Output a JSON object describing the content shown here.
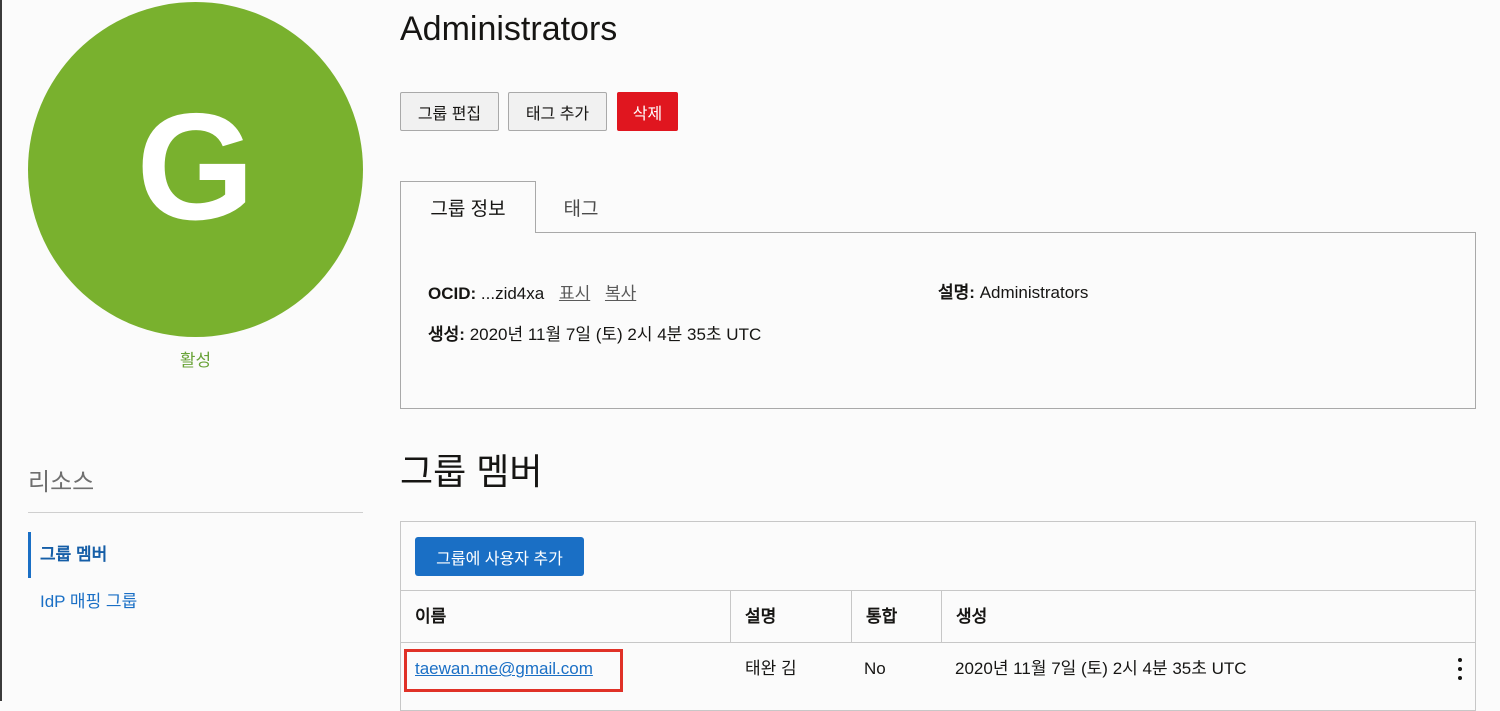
{
  "group": {
    "avatar_letter": "G",
    "status": "활성",
    "name": "Administrators"
  },
  "actions": {
    "edit": "그룹 편집",
    "add_tags": "태그 추가",
    "delete": "삭제"
  },
  "tabs": [
    "그룹 정보",
    "태그"
  ],
  "info": {
    "ocid_label": "OCID:",
    "ocid_value": "...zid4xa",
    "show_link": "표시",
    "copy_link": "복사",
    "created_label": "생성:",
    "created_value": "2020년 11월 7일 (토) 2시 4분 35초 UTC",
    "description_label": "설명:",
    "description_value": "Administrators"
  },
  "resources": {
    "title": "리소스",
    "items": [
      "그룹 멤버",
      "IdP 매핑 그룹"
    ]
  },
  "members": {
    "title": "그룹 멤버",
    "add_button": "그룹에 사용자 추가",
    "columns": [
      "이름",
      "설명",
      "통합",
      "생성"
    ],
    "rows": [
      {
        "name": "taewan.me@gmail.com",
        "description": "태완 김",
        "federated": "No",
        "created": "2020년 11월 7일 (토) 2시 4분 35초 UTC"
      }
    ]
  },
  "colors": {
    "avatar": "#79b12e",
    "status": "#6aa339",
    "primary": "#1a6fc5",
    "danger": "#e0161f",
    "highlight": "#e03127"
  }
}
